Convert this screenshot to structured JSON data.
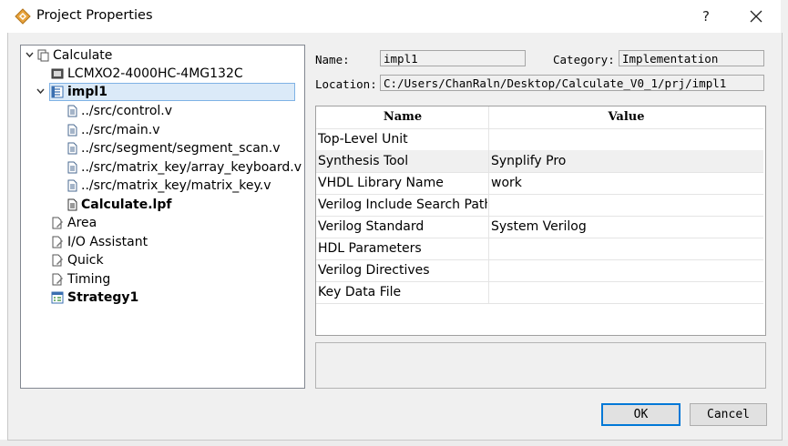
{
  "window": {
    "title": "Project Properties",
    "help_label": "?"
  },
  "tree": {
    "root": "Calculate",
    "device": "LCMXO2-4000HC-4MG132C",
    "impl": "impl1",
    "files": [
      "../src/control.v",
      "../src/main.v",
      "../src/segment/segment_scan.v",
      "../src/matrix_key/array_keyboard.v",
      "../src/matrix_key/matrix_key.v"
    ],
    "lpf": "Calculate.lpf",
    "tools": [
      "Area",
      "I/O Assistant",
      "Quick",
      "Timing"
    ],
    "strategy": "Strategy1"
  },
  "form": {
    "name_label": "Name:",
    "name_value": "impl1",
    "category_label": "Category:",
    "category_value": "Implementation",
    "location_label": "Location:",
    "location_value": "C:/Users/ChanRaln/Desktop/Calculate_V0_1/prj/impl1"
  },
  "grid": {
    "headers": {
      "name": "Name",
      "value": "Value"
    },
    "rows": [
      {
        "name": "Top-Level Unit",
        "value": ""
      },
      {
        "name": "Synthesis Tool",
        "value": "Synplify Pro"
      },
      {
        "name": "VHDL Library Name",
        "value": "work"
      },
      {
        "name": "Verilog Include Search Path",
        "value": ""
      },
      {
        "name": "Verilog Standard",
        "value": "System Verilog"
      },
      {
        "name": "HDL Parameters",
        "value": ""
      },
      {
        "name": "Verilog Directives",
        "value": ""
      },
      {
        "name": "Key Data File",
        "value": ""
      }
    ]
  },
  "buttons": {
    "ok": "OK",
    "cancel": "Cancel"
  },
  "colors": {
    "accent": "#0078d7",
    "selection": "#dbeaf8",
    "icon_orange": "#e8a33c"
  }
}
